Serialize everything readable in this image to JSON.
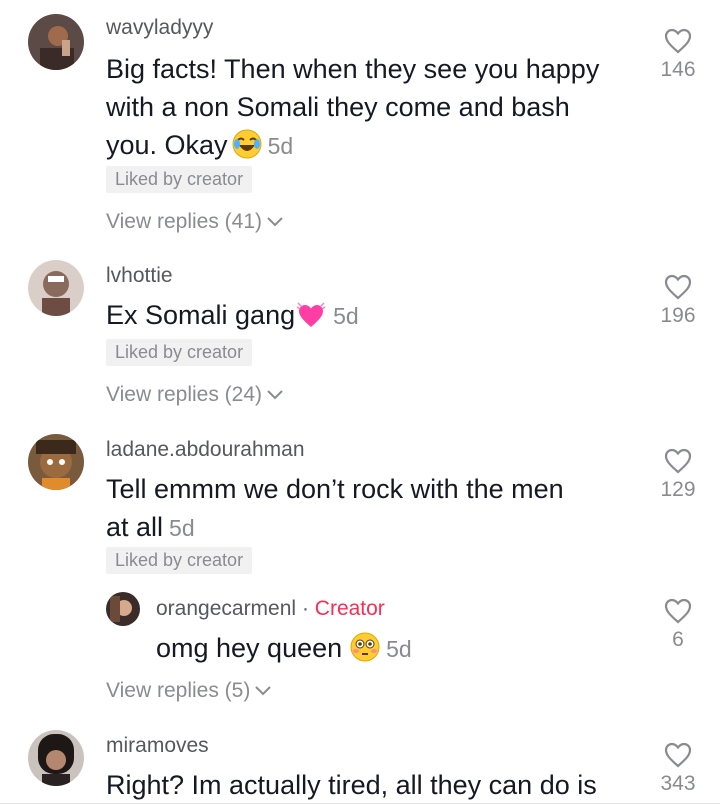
{
  "comments": [
    {
      "username": "wavyladyyy",
      "text_line1": "Big facts! Then when they see you happy",
      "text_line2": "with a non Somali they come and bash",
      "text_line3": "you. Okay",
      "time": "5d",
      "emoji": "joy-emoji",
      "badge": "Liked by creator",
      "likes": "146",
      "view_replies": "View replies (41)"
    },
    {
      "username": "lvhottie",
      "text_line1": "Ex Somali gang",
      "time": "5d",
      "emoji": "growing-heart-emoji",
      "badge": "Liked by creator",
      "likes": "196",
      "view_replies": "View replies (24)"
    },
    {
      "username": "ladane.abdourahman",
      "text_line1": "Tell emmm we don’t rock with the men",
      "text_line2": "at all",
      "time": "5d",
      "badge": "Liked by creator",
      "likes": "129",
      "view_replies": "View replies (5)",
      "reply": {
        "username": "orangecarmenl",
        "separator": "·",
        "role": "Creator",
        "text": "omg hey queen",
        "emoji": "flushed-emoji",
        "time": "5d",
        "likes": "6"
      }
    },
    {
      "username": "miramoves",
      "text_line1": "Right? Im actually tired, all they can do is",
      "likes": "343"
    }
  ],
  "colors": {
    "text": "#161823",
    "muted": "#8a8b91",
    "creator": "#fe2c55",
    "badge_bg": "#f1f1f2"
  }
}
